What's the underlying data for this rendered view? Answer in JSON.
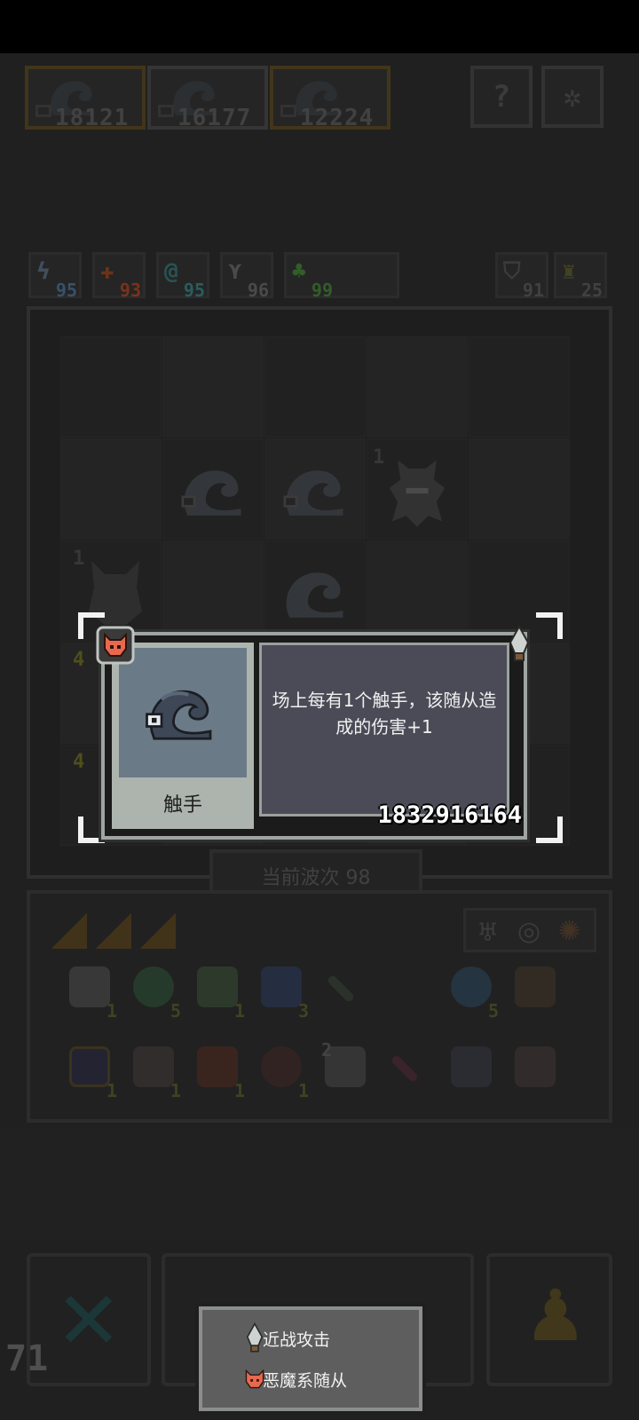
{
  "top_bar": {
    "slots": [
      {
        "number": "18121"
      },
      {
        "number": "16177"
      },
      {
        "number": "12224"
      }
    ],
    "help_glyph": "?",
    "settings_icon": "gear-icon"
  },
  "stats": {
    "chips": [
      {
        "icon": "lightning-icon",
        "value": "95",
        "color": "#4a6a8a"
      },
      {
        "icon": "cross-icon",
        "value": "93",
        "color": "#a04a2a"
      },
      {
        "icon": "swirl-icon",
        "value": "95",
        "color": "#3a7a7a"
      },
      {
        "icon": "wing-icon",
        "value": "96",
        "color": "#6a6a6a"
      },
      {
        "icon": "clover-icon",
        "value": "99",
        "color": "#4a7a3a"
      }
    ],
    "right_chips": [
      {
        "icon": "shield-icon",
        "value": "91"
      },
      {
        "icon": "sword-icon",
        "value": "25"
      }
    ]
  },
  "board": {
    "pieces": [
      {
        "type": "tentacle",
        "level": ""
      },
      {
        "type": "tentacle",
        "level": ""
      },
      {
        "type": "beast",
        "level": "1"
      },
      {
        "type": "demon",
        "level": "1"
      },
      {
        "type": "tentacle",
        "level": ""
      },
      {
        "type": "minion",
        "level": "4"
      },
      {
        "type": "minion",
        "level": "4"
      }
    ],
    "wave_label": "当前波次 98"
  },
  "inventory": {
    "items": [
      {
        "icon": "scroll-icon",
        "count": "1"
      },
      {
        "icon": "gem-icon",
        "count": "5"
      },
      {
        "icon": "goblin-icon",
        "count": "1"
      },
      {
        "icon": "hourglass-icon",
        "count": "3"
      },
      {
        "icon": "arrow-icon",
        "count": ""
      },
      {
        "icon": "orb-icon",
        "count": "5"
      },
      {
        "icon": "claw-icon",
        "count": ""
      },
      {
        "icon": "jar-icon",
        "count": "1"
      },
      {
        "icon": "totem-icon",
        "count": "1"
      },
      {
        "icon": "axe-icon",
        "count": "1"
      },
      {
        "icon": "helmet-icon",
        "count": "1"
      },
      {
        "icon": "dice-icon",
        "count": "2"
      },
      {
        "icon": "arrow-icon",
        "count": ""
      },
      {
        "icon": "spider-icon",
        "count": ""
      },
      {
        "icon": "hand-icon",
        "count": ""
      }
    ]
  },
  "wave_count": "71",
  "card": {
    "name": "触手",
    "description": "场上每有1个触手，该随从造成的伤害+1",
    "id": "1832916164"
  },
  "legend": {
    "items": [
      {
        "icon": "melee-icon",
        "label": "近战攻击"
      },
      {
        "icon": "demon-icon",
        "label": "恶魔系随从"
      }
    ]
  },
  "colors": {
    "card_border": "#9fa6a2",
    "card_desc_bg": "#4b4b58",
    "portrait_bg": "#6b7a87",
    "demon_accent": "#e8694e"
  }
}
